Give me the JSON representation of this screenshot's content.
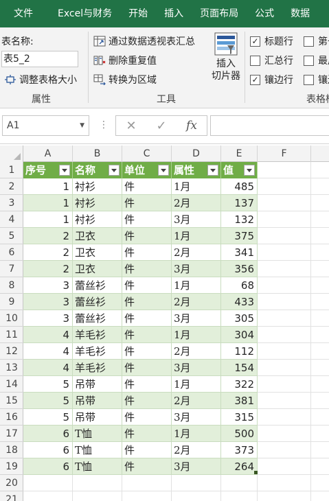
{
  "ribbon_tabs": [
    "文件",
    "Excel与财务",
    "开始",
    "插入",
    "页面布局",
    "公式",
    "数据"
  ],
  "properties": {
    "table_name_label": "表名称:",
    "table_name_value": "表5_2",
    "resize_label": "调整表格大小",
    "group_label": "属性"
  },
  "tools": {
    "pivot_label": "通过数据透视表汇总",
    "dedupe_label": "删除重复值",
    "convert_label": "转换为区域",
    "slicer_line1": "插入",
    "slicer_line2": "切片器",
    "group_label": "工具"
  },
  "style_options": {
    "header_row": "标题行",
    "total_row": "汇总行",
    "banded_rows": "镶边行",
    "first_col": "第一",
    "last_col": "最后",
    "banded_cols": "镶边",
    "group_label": "表格样",
    "checked": {
      "header_row": "✓",
      "total_row": "",
      "banded_rows": "✓",
      "first_col": "",
      "last_col": "",
      "banded_cols": ""
    }
  },
  "formula_bar": {
    "name_box": "A1",
    "cancel": "✕",
    "enter": "✓",
    "fx": "fx",
    "dots": "⋮"
  },
  "columns": [
    "A",
    "B",
    "C",
    "D",
    "E",
    "F"
  ],
  "row_numbers": [
    "1",
    "2",
    "3",
    "4",
    "5",
    "6",
    "7",
    "8",
    "9",
    "10",
    "11",
    "12",
    "13",
    "14",
    "15",
    "16",
    "17",
    "18",
    "19",
    "20",
    "21"
  ],
  "table": {
    "headers": [
      "序号",
      "名称",
      "单位",
      "属性",
      "值"
    ],
    "rows": [
      [
        "1",
        "衬衫",
        "件",
        "1月",
        "485"
      ],
      [
        "1",
        "衬衫",
        "件",
        "2月",
        "137"
      ],
      [
        "1",
        "衬衫",
        "件",
        "3月",
        "132"
      ],
      [
        "2",
        "卫衣",
        "件",
        "1月",
        "375"
      ],
      [
        "2",
        "卫衣",
        "件",
        "2月",
        "341"
      ],
      [
        "2",
        "卫衣",
        "件",
        "3月",
        "356"
      ],
      [
        "3",
        "蕾丝衫",
        "件",
        "1月",
        "68"
      ],
      [
        "3",
        "蕾丝衫",
        "件",
        "2月",
        "433"
      ],
      [
        "3",
        "蕾丝衫",
        "件",
        "3月",
        "305"
      ],
      [
        "4",
        "羊毛衫",
        "件",
        "1月",
        "304"
      ],
      [
        "4",
        "羊毛衫",
        "件",
        "2月",
        "112"
      ],
      [
        "4",
        "羊毛衫",
        "件",
        "3月",
        "154"
      ],
      [
        "5",
        "吊带",
        "件",
        "1月",
        "322"
      ],
      [
        "5",
        "吊带",
        "件",
        "2月",
        "381"
      ],
      [
        "5",
        "吊带",
        "件",
        "3月",
        "315"
      ],
      [
        "6",
        "T恤",
        "件",
        "1月",
        "500"
      ],
      [
        "6",
        "T恤",
        "件",
        "2月",
        "373"
      ],
      [
        "6",
        "T恤",
        "件",
        "3月",
        "264"
      ]
    ]
  },
  "colors": {
    "ribbon_green": "#217346",
    "table_header": "#70ad47",
    "table_band": "#e2efda"
  }
}
